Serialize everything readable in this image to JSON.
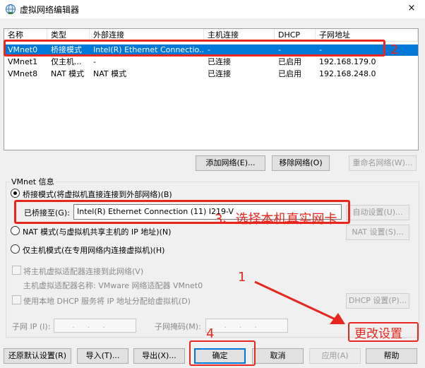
{
  "window": {
    "title": "虚拟网络编辑器",
    "close": "×"
  },
  "list": {
    "headers": [
      "名称",
      "类型",
      "外部连接",
      "主机连接",
      "DHCP",
      "子网地址"
    ],
    "rows": [
      [
        "VMnet0",
        "桥接模式",
        "Intel(R) Ethernet Connectio...",
        "-",
        "-",
        "-"
      ],
      [
        "VMnet1",
        "仅主机...",
        "-",
        "已连接",
        "已启用",
        "192.168.179.0"
      ],
      [
        "VMnet8",
        "NAT 模式",
        "NAT 模式",
        "已连接",
        "已启用",
        "192.168.248.0"
      ]
    ]
  },
  "net_buttons": {
    "add": "添加网络(E)...",
    "remove": "移除网络(O)",
    "rename": "重命名网络(W)..."
  },
  "vmnet_info": {
    "title": "VMnet 信息",
    "bridge_label": "桥接模式(将虚拟机直接连接到外部网络)(B)",
    "bridged_to_label": "已桥接至(G):",
    "bridged_to_value": "Intel(R) Ethernet Connection (11) I219-V",
    "auto_settings": "自动设置(U)...",
    "nat_label": "NAT 模式(与虚拟机共享主机的 IP 地址)(N)",
    "nat_settings": "NAT 设置(S)...",
    "host_only_label": "仅主机模式(在专用网络内连接虚拟机)(H)",
    "connect_adapter_label": "将主机虚拟适配器连接到此网络(V)",
    "adapter_name_label": "主机虚拟适配器名称: VMware 网络适配器 VMnet0",
    "dhcp_label": "使用本地 DHCP 服务将 IP 地址分配给虚拟机(D)",
    "dhcp_settings": "DHCP 设置(P)...",
    "subnet_ip_label": "子网 IP (I):",
    "subnet_mask_label": "子网掩码(M):",
    "ip_placeholder": "...",
    "mask_placeholder": "..."
  },
  "bottom_buttons": {
    "restore": "还原默认设置(R)",
    "import": "导入(T)...",
    "export": "导出(X)...",
    "ok": "确定",
    "cancel": "取消",
    "apply": "应用(A)",
    "help": "帮助"
  },
  "annotations": {
    "n1": "1",
    "n2": "2",
    "n3": "3、选择本机真实网卡",
    "n4": "4",
    "change_settings": "更改设置",
    "color": "#e8261d"
  },
  "colors": {
    "selection": "#0078d7",
    "annotation": "#e8261d"
  }
}
